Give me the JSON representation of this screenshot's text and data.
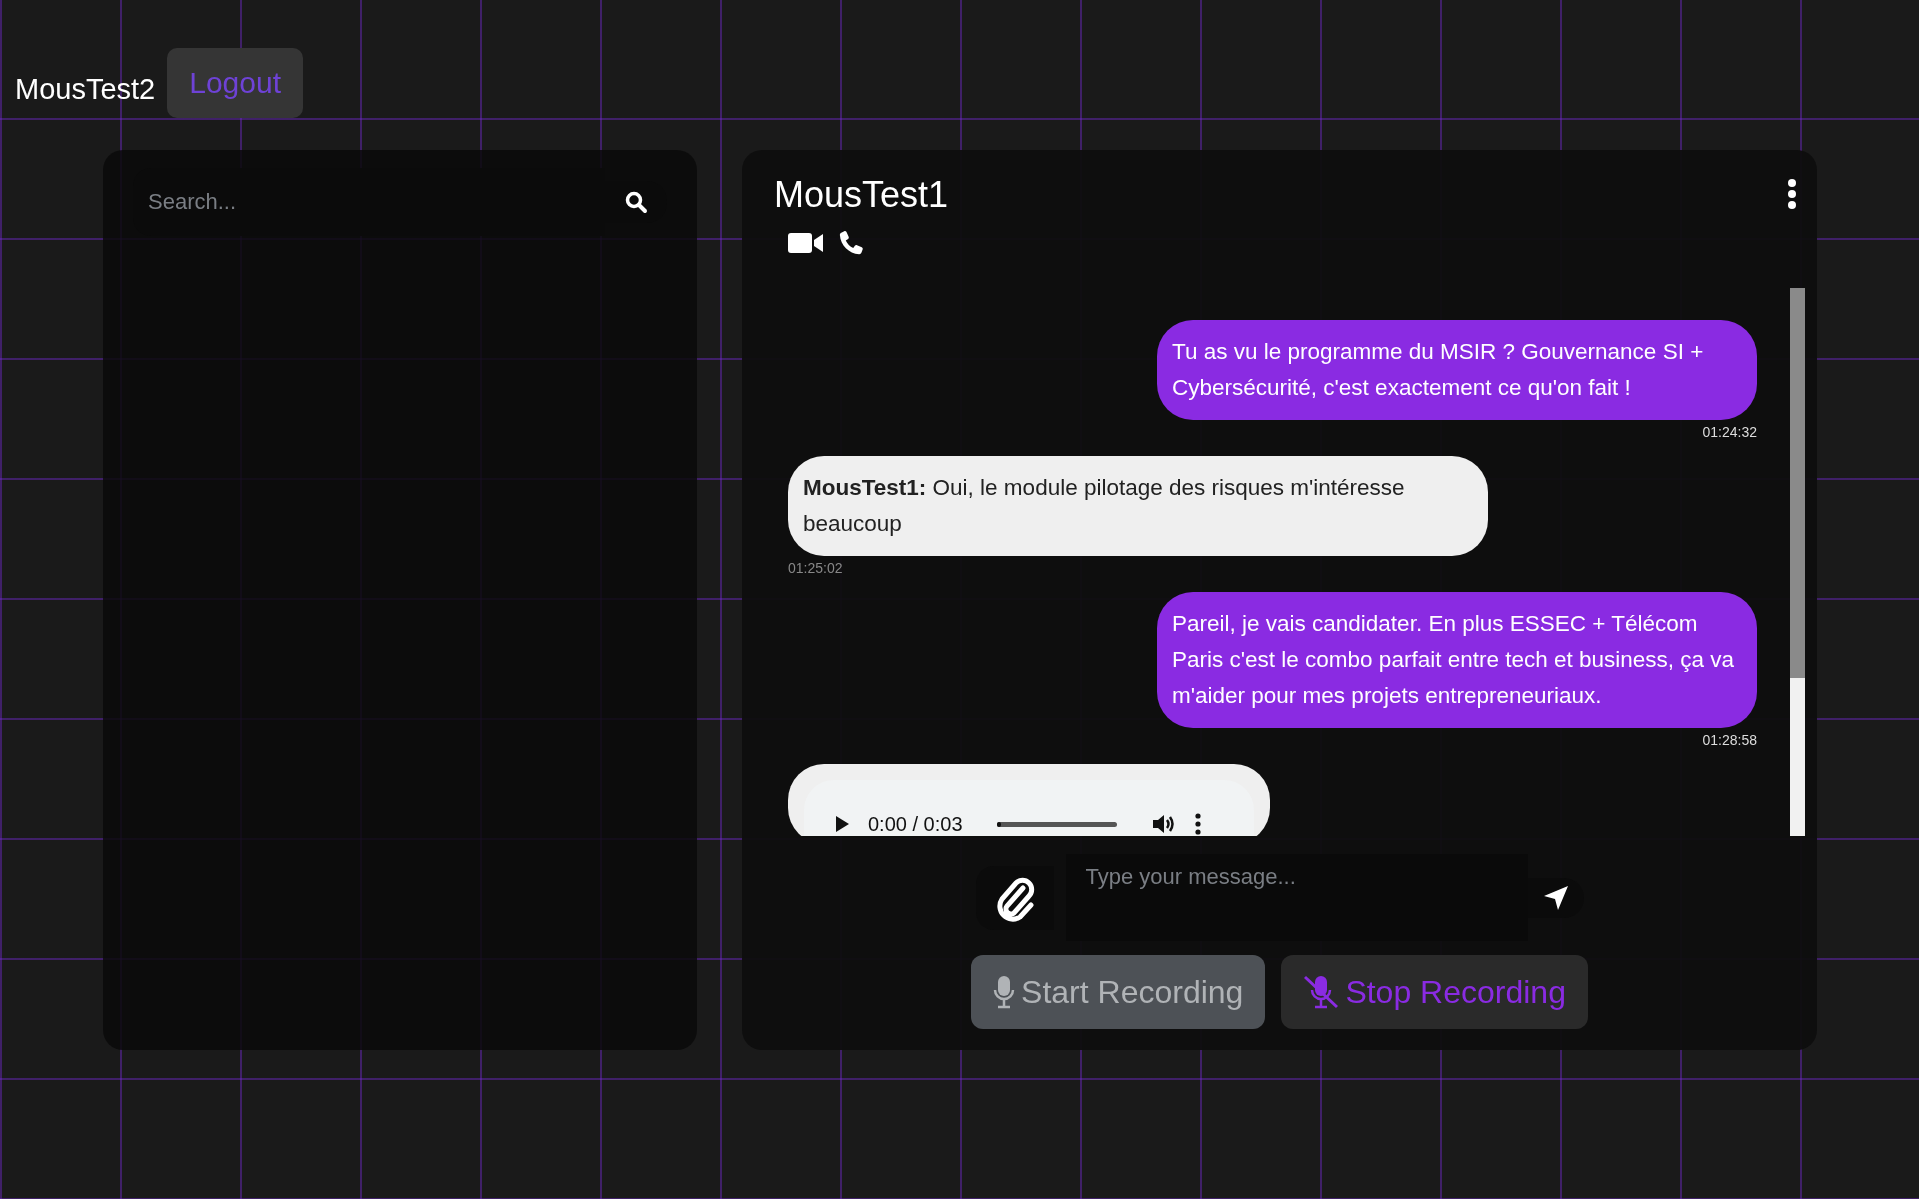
{
  "header": {
    "username": "MousTest2",
    "logout": "Logout"
  },
  "sidebar": {
    "search": {
      "placeholder": "Search..."
    }
  },
  "chat": {
    "title": "MousTest1",
    "messages": [
      {
        "kind": "sent",
        "text": "Tu as vu le programme du MSIR ? Gouvernance SI + Cybersécurité, c'est exactement ce qu'on fait !",
        "time": "01:24:32"
      },
      {
        "kind": "received",
        "text": "**MousTest1:** Oui, le module pilotage des risques m'intéresse beaucoup",
        "time": "01:25:02"
      },
      {
        "kind": "sent",
        "text": "Pareil, je vais candidater. En plus ESSEC + Télécom Paris c'est le combo parfait entre tech et business, ça va m'aider pour mes projets entrepreneuriaux.",
        "time": "01:28:58"
      },
      {
        "kind": "audio",
        "duration": "0:00 / 0:03",
        "level": 0
      }
    ],
    "input": {
      "placeholder": "Type your message..."
    },
    "recording": [
      {
        "kind": "start",
        "label": "Start Recording",
        "disabled": true
      },
      {
        "kind": "stop",
        "label": "Stop Recording",
        "disabled": false
      }
    ]
  }
}
